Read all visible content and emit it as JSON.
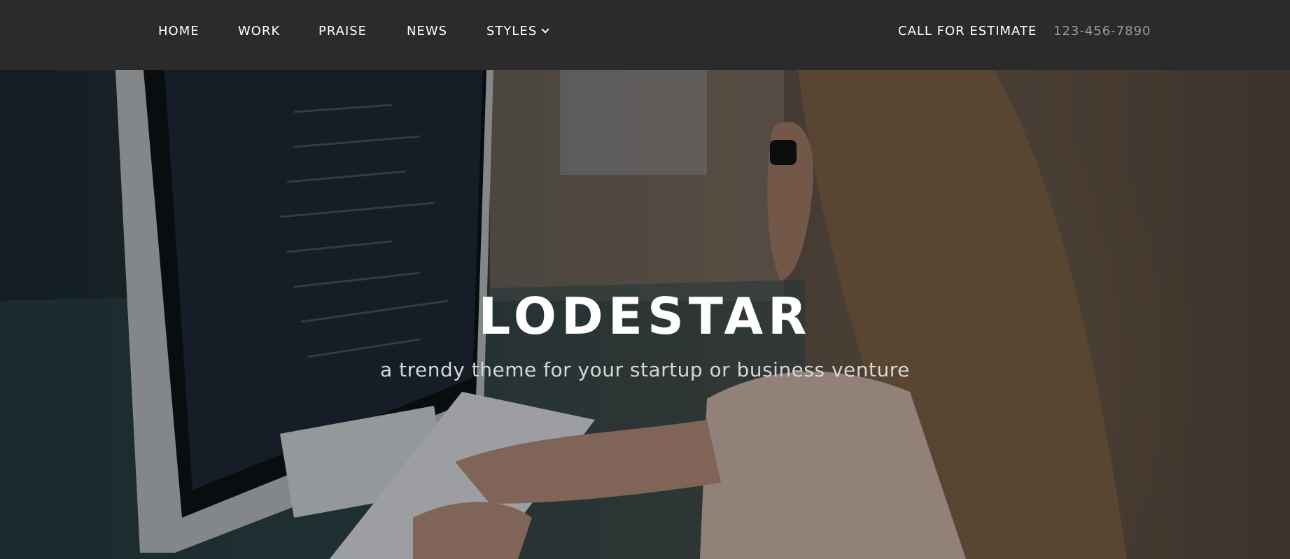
{
  "nav": {
    "items": [
      {
        "label": "HOME"
      },
      {
        "label": "WORK"
      },
      {
        "label": "PRAISE"
      },
      {
        "label": "NEWS"
      },
      {
        "label": "STYLES"
      }
    ],
    "cta_label": "CALL FOR ESTIMATE",
    "phone": "123-456-7890"
  },
  "hero": {
    "title": "LODESTAR",
    "subtitle": "a trendy theme for your startup or business venture",
    "background_icon": "woman-at-computer-photo"
  },
  "colors": {
    "navbar_bg": "#2b2b2b",
    "nav_text": "#ffffff",
    "phone_text": "#9b9b9b"
  }
}
